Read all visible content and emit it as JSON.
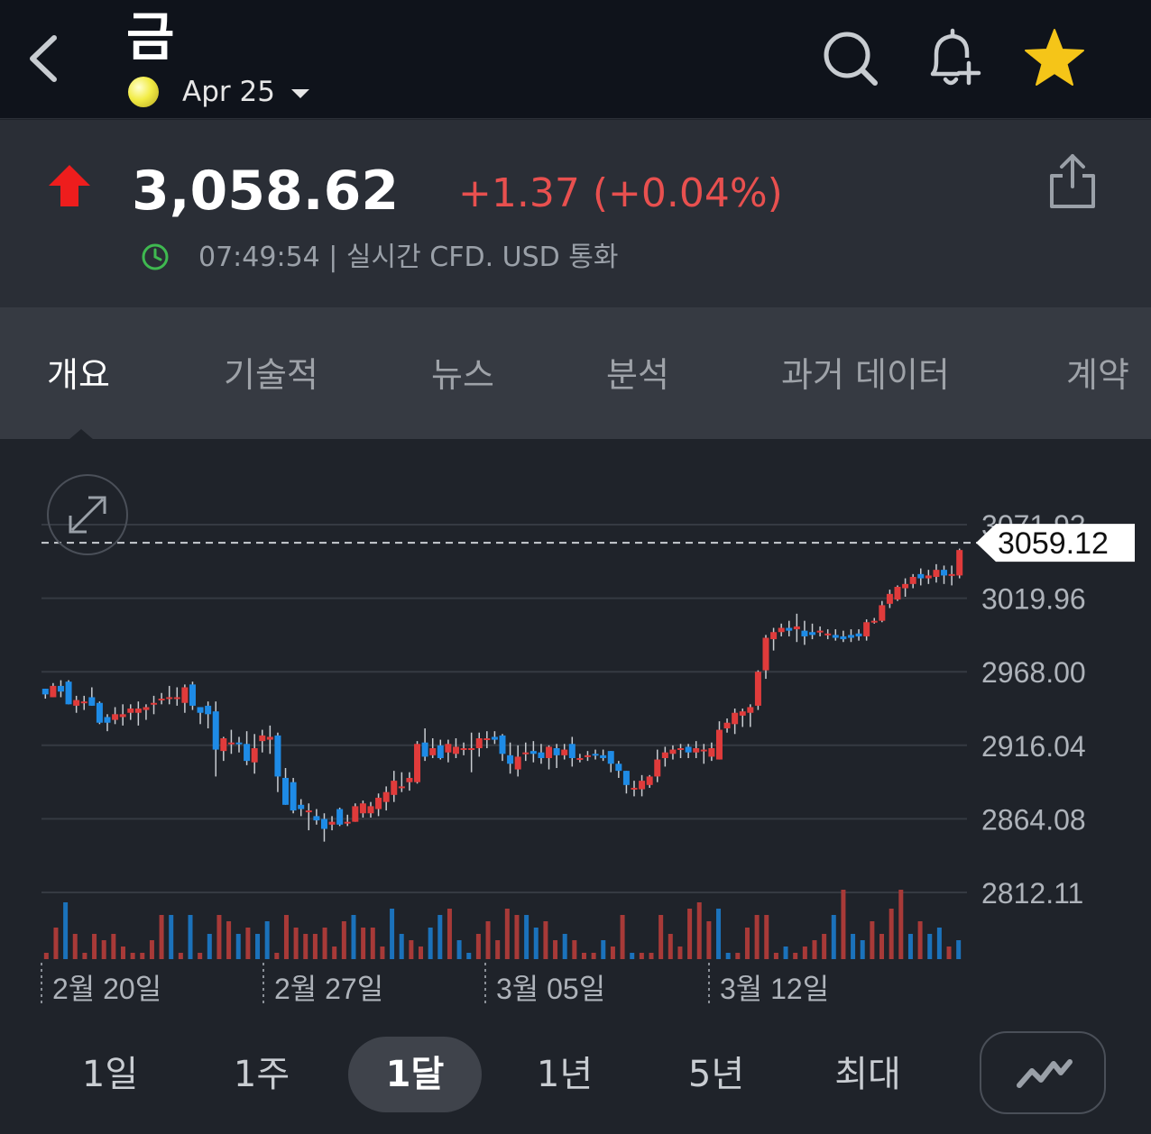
{
  "header": {
    "title": "금",
    "contract": "Apr 25",
    "icons": [
      "back-icon",
      "search-icon",
      "bell-plus-icon",
      "star-icon"
    ],
    "star_color": "#f5c518"
  },
  "quote": {
    "price": "3,058.62",
    "change": "+1.37 (+0.04%)",
    "time": "07:49:54",
    "meta_rest": " | 실시간 CFD. USD 통화",
    "up_color": "#e8504f",
    "arrow_color": "#ee1d1d"
  },
  "tabs": [
    "개요",
    "기술적",
    "뉴스",
    "분석",
    "과거 데이터",
    "계약"
  ],
  "active_tab": "개요",
  "chart_data": {
    "type": "candlestick",
    "y_ticks": [
      "3071.93",
      "3019.96",
      "2968.00",
      "2916.04",
      "2864.08",
      "2812.11"
    ],
    "x_ticks": [
      "2월 20일",
      "2월 27일",
      "3월 05일",
      "3월 12일"
    ],
    "last_price": "3059.12",
    "ylim": [
      2812.11,
      3071.93
    ],
    "grid": true,
    "up_color": "#e03b3b",
    "down_color": "#1e8be6",
    "candles": [
      [
        2956,
        2956,
        2949,
        2952
      ],
      [
        2950,
        2960,
        2950,
        2958
      ],
      [
        2958,
        2962,
        2950,
        2954
      ],
      [
        2961,
        2962,
        2945,
        2945
      ],
      [
        2944,
        2951,
        2939,
        2948
      ],
      [
        2946,
        2951,
        2941,
        2947
      ],
      [
        2950,
        2957,
        2944,
        2944
      ],
      [
        2946,
        2947,
        2931,
        2932
      ],
      [
        2936,
        2938,
        2926,
        2932
      ],
      [
        2934,
        2943,
        2931,
        2938
      ],
      [
        2936,
        2945,
        2930,
        2938
      ],
      [
        2939,
        2945,
        2934,
        2942
      ],
      [
        2939,
        2947,
        2930,
        2942
      ],
      [
        2941,
        2945,
        2934,
        2943
      ],
      [
        2945,
        2951,
        2938,
        2946
      ],
      [
        2949,
        2953,
        2945,
        2949
      ],
      [
        2949,
        2958,
        2945,
        2950
      ],
      [
        2950,
        2957,
        2944,
        2950
      ],
      [
        2946,
        2959,
        2939,
        2957
      ],
      [
        2959,
        2961,
        2941,
        2944
      ],
      [
        2943,
        2943,
        2931,
        2939
      ],
      [
        2944,
        2947,
        2928,
        2938
      ],
      [
        2940,
        2947,
        2894,
        2913
      ],
      [
        2912,
        2922,
        2905,
        2921
      ],
      [
        2918,
        2927,
        2910,
        2918
      ],
      [
        2918,
        2922,
        2911,
        2917
      ],
      [
        2917,
        2926,
        2902,
        2905
      ],
      [
        2904,
        2924,
        2896,
        2914
      ],
      [
        2919,
        2927,
        2911,
        2923
      ],
      [
        2920,
        2930,
        2910,
        2922
      ],
      [
        2923,
        2925,
        2883,
        2894
      ],
      [
        2893,
        2900,
        2874,
        2874
      ],
      [
        2890,
        2893,
        2868,
        2870
      ],
      [
        2874,
        2878,
        2866,
        2871
      ],
      [
        2870,
        2875,
        2856,
        2870
      ],
      [
        2866,
        2871,
        2860,
        2863
      ],
      [
        2864,
        2868,
        2848,
        2857
      ],
      [
        2860,
        2866,
        2856,
        2862
      ],
      [
        2871,
        2872,
        2859,
        2860
      ],
      [
        2862,
        2867,
        2859,
        2862
      ],
      [
        2862,
        2875,
        2862,
        2873
      ],
      [
        2868,
        2877,
        2865,
        2875
      ],
      [
        2868,
        2876,
        2865,
        2873
      ],
      [
        2871,
        2882,
        2866,
        2879
      ],
      [
        2876,
        2887,
        2870,
        2883
      ],
      [
        2881,
        2898,
        2876,
        2891
      ],
      [
        2887,
        2897,
        2883,
        2887
      ],
      [
        2890,
        2897,
        2884,
        2893
      ],
      [
        2890,
        2919,
        2889,
        2917
      ],
      [
        2918,
        2928,
        2905,
        2908
      ],
      [
        2909,
        2921,
        2907,
        2914
      ],
      [
        2916,
        2920,
        2906,
        2907
      ],
      [
        2911,
        2920,
        2904,
        2917
      ],
      [
        2910,
        2921,
        2907,
        2915
      ],
      [
        2913,
        2918,
        2909,
        2914
      ],
      [
        2914,
        2925,
        2897,
        2914
      ],
      [
        2914,
        2925,
        2908,
        2921
      ],
      [
        2921,
        2926,
        2914,
        2921
      ],
      [
        2922,
        2926,
        2917,
        2920
      ],
      [
        2923,
        2924,
        2905,
        2910
      ],
      [
        2909,
        2918,
        2896,
        2903
      ],
      [
        2899,
        2916,
        2894,
        2908
      ],
      [
        2910,
        2918,
        2905,
        2911
      ],
      [
        2912,
        2919,
        2904,
        2910
      ],
      [
        2911,
        2917,
        2903,
        2907
      ],
      [
        2907,
        2916,
        2899,
        2915
      ],
      [
        2914,
        2917,
        2900,
        2909
      ],
      [
        2909,
        2917,
        2906,
        2913
      ],
      [
        2917,
        2922,
        2901,
        2907
      ],
      [
        2906,
        2910,
        2904,
        2907
      ],
      [
        2909,
        2912,
        2905,
        2909
      ],
      [
        2910,
        2913,
        2906,
        2909
      ],
      [
        2909,
        2913,
        2905,
        2907
      ],
      [
        2912,
        2912,
        2897,
        2903
      ],
      [
        2903,
        2905,
        2893,
        2898
      ],
      [
        2898,
        2898,
        2882,
        2888
      ],
      [
        2885,
        2891,
        2880,
        2886
      ],
      [
        2885,
        2895,
        2880,
        2891
      ],
      [
        2888,
        2895,
        2886,
        2894
      ],
      [
        2894,
        2913,
        2890,
        2906
      ],
      [
        2907,
        2915,
        2901,
        2911
      ],
      [
        2910,
        2916,
        2906,
        2913
      ],
      [
        2914,
        2917,
        2907,
        2914
      ],
      [
        2915,
        2917,
        2907,
        2911
      ],
      [
        2911,
        2919,
        2907,
        2914
      ],
      [
        2912,
        2917,
        2903,
        2913
      ],
      [
        2908,
        2918,
        2905,
        2914
      ],
      [
        2906,
        2933,
        2906,
        2927
      ],
      [
        2928,
        2935,
        2925,
        2932
      ],
      [
        2931,
        2942,
        2924,
        2939
      ],
      [
        2937,
        2942,
        2929,
        2940
      ],
      [
        2939,
        2945,
        2929,
        2943
      ],
      [
        2944,
        2969,
        2941,
        2968
      ],
      [
        2969,
        2994,
        2963,
        2992
      ],
      [
        2991,
        2999,
        2983,
        2996
      ],
      [
        2996,
        3002,
        2993,
        2999
      ],
      [
        2999,
        3004,
        2993,
        2997
      ],
      [
        2998,
        3009,
        2989,
        3000
      ],
      [
        2997,
        3004,
        2987,
        2993
      ],
      [
        2996,
        3002,
        2991,
        2994
      ],
      [
        2997,
        3000,
        2993,
        2997
      ],
      [
        2994,
        2998,
        2991,
        2995
      ],
      [
        2994,
        2998,
        2990,
        2992
      ],
      [
        2993,
        2997,
        2989,
        2991
      ],
      [
        2994,
        2998,
        2989,
        2992
      ],
      [
        2995,
        2998,
        2990,
        2993
      ],
      [
        2993,
        3005,
        2990,
        3003
      ],
      [
        3004,
        3006,
        3002,
        3004
      ],
      [
        3004,
        3018,
        3003,
        3015
      ],
      [
        3016,
        3026,
        3013,
        3023
      ],
      [
        3019,
        3029,
        3018,
        3028
      ],
      [
        3027,
        3034,
        3021,
        3030
      ],
      [
        3030,
        3037,
        3027,
        3035
      ],
      [
        3037,
        3041,
        3029,
        3034
      ],
      [
        3034,
        3040,
        3030,
        3036
      ],
      [
        3035,
        3044,
        3031,
        3040
      ],
      [
        3040,
        3043,
        3030,
        3036
      ],
      [
        3036,
        3043,
        3029,
        3037
      ],
      [
        3036,
        3055,
        3034,
        3054
      ]
    ],
    "volumes": [
      [
        1,
        1
      ],
      [
        5,
        1
      ],
      [
        9,
        -1
      ],
      [
        4,
        1
      ],
      [
        1,
        1
      ],
      [
        4,
        1
      ],
      [
        3,
        1
      ],
      [
        4,
        1
      ],
      [
        2,
        1
      ],
      [
        1,
        1
      ],
      [
        1,
        1
      ],
      [
        3,
        1
      ],
      [
        7,
        1
      ],
      [
        7,
        -1
      ],
      [
        1,
        1
      ],
      [
        7,
        -1
      ],
      [
        1,
        1
      ],
      [
        4,
        -1
      ],
      [
        7,
        1
      ],
      [
        6,
        1
      ],
      [
        4,
        -1
      ],
      [
        5,
        1
      ],
      [
        4,
        -1
      ],
      [
        6,
        -1
      ],
      [
        1,
        1
      ],
      [
        7,
        1
      ],
      [
        5,
        1
      ],
      [
        4,
        1
      ],
      [
        4,
        1
      ],
      [
        5,
        1
      ],
      [
        2,
        1
      ],
      [
        6,
        1
      ],
      [
        7,
        -1
      ],
      [
        5,
        1
      ],
      [
        5,
        1
      ],
      [
        2,
        1
      ],
      [
        8,
        -1
      ],
      [
        4,
        -1
      ],
      [
        3,
        1
      ],
      [
        2,
        1
      ],
      [
        5,
        -1
      ],
      [
        7,
        -1
      ],
      [
        8,
        1
      ],
      [
        3,
        -1
      ],
      [
        1,
        -1
      ],
      [
        4,
        1
      ],
      [
        6,
        1
      ],
      [
        3,
        1
      ],
      [
        8,
        1
      ],
      [
        7,
        1
      ],
      [
        7,
        -1
      ],
      [
        5,
        -1
      ],
      [
        6,
        1
      ],
      [
        3,
        1
      ],
      [
        4,
        -1
      ],
      [
        3,
        1
      ],
      [
        1,
        1
      ],
      [
        1,
        1
      ],
      [
        3,
        -1
      ],
      [
        2,
        1
      ],
      [
        7,
        1
      ],
      [
        1,
        -1
      ],
      [
        1,
        1
      ],
      [
        1,
        1
      ],
      [
        7,
        1
      ],
      [
        4,
        1
      ],
      [
        2,
        1
      ],
      [
        8,
        1
      ],
      [
        9,
        1
      ],
      [
        6,
        1
      ],
      [
        8,
        -1
      ],
      [
        1,
        -1
      ],
      [
        1,
        1
      ],
      [
        5,
        1
      ],
      [
        7,
        1
      ],
      [
        7,
        1
      ],
      [
        1,
        1
      ],
      [
        2,
        -1
      ],
      [
        1,
        1
      ],
      [
        2,
        1
      ],
      [
        3,
        1
      ],
      [
        4,
        1
      ],
      [
        7,
        -1
      ],
      [
        11,
        1
      ],
      [
        4,
        -1
      ],
      [
        3,
        -1
      ],
      [
        6,
        1
      ],
      [
        4,
        1
      ],
      [
        8,
        1
      ],
      [
        11,
        1
      ],
      [
        4,
        -1
      ],
      [
        6,
        1
      ],
      [
        4,
        -1
      ],
      [
        5,
        -1
      ],
      [
        2,
        1
      ],
      [
        3,
        -1
      ]
    ]
  },
  "ranges": [
    "1일",
    "1주",
    "1달",
    "1년",
    "5년",
    "최대"
  ],
  "active_range": "1달"
}
